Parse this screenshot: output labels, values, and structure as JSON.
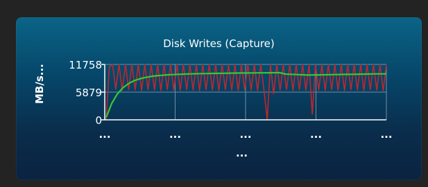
{
  "chart_data": {
    "type": "line",
    "title": "Disk Writes (Capture)",
    "ylabel": "MB/s...",
    "xlabel": "...",
    "ylim": [
      0,
      11758
    ],
    "y_ticks": [
      "11758",
      "5879",
      "0"
    ],
    "x_ticks": [
      "...",
      "...",
      "...",
      "...",
      "..."
    ],
    "grid": true,
    "series": [
      {
        "color": "#c0272d",
        "values": [
          0,
          11200,
          11758,
          6500,
          11758,
          6200,
          11758,
          6400,
          11758,
          6300,
          11758,
          6200,
          11758,
          6400,
          11758,
          6300,
          11758,
          6200,
          11758,
          6400,
          11758,
          6300,
          11758,
          6200,
          11758,
          6400,
          11758,
          6300,
          11758,
          6200,
          11758,
          6400,
          11758,
          6300,
          11758,
          6200,
          11758,
          6400,
          11758,
          6300,
          11758,
          6200,
          11758,
          6400,
          11758,
          6300,
          11758,
          6200,
          11758,
          6400,
          0,
          11758,
          5500,
          11758,
          6300,
          11758,
          6400,
          11758,
          6200,
          11758,
          6400,
          11758,
          6300,
          11758,
          1200,
          11758,
          6300,
          11758,
          6200,
          11758,
          6400,
          11758,
          6300,
          11758,
          6200,
          11758,
          6400,
          11758,
          6300,
          11758,
          6200,
          11758,
          6400,
          11758,
          6300,
          11758,
          6200,
          11758
        ]
      },
      {
        "color": "#33cc33",
        "values": [
          500,
          3500,
          5500,
          6800,
          7700,
          8300,
          8700,
          9000,
          9200,
          9350,
          9450,
          9550,
          9600,
          9650,
          9700,
          9750,
          9780,
          9800,
          9820,
          9840,
          9860,
          9880,
          9900,
          9920,
          9930,
          9940,
          9950,
          9960,
          9970,
          9980,
          9990,
          10000,
          9700,
          9650,
          9600,
          9550,
          9500,
          9520,
          9540,
          9560,
          9580,
          9600,
          9620,
          9640,
          9660,
          9680,
          9700,
          9720,
          9740,
          9750,
          9760
        ]
      }
    ]
  }
}
